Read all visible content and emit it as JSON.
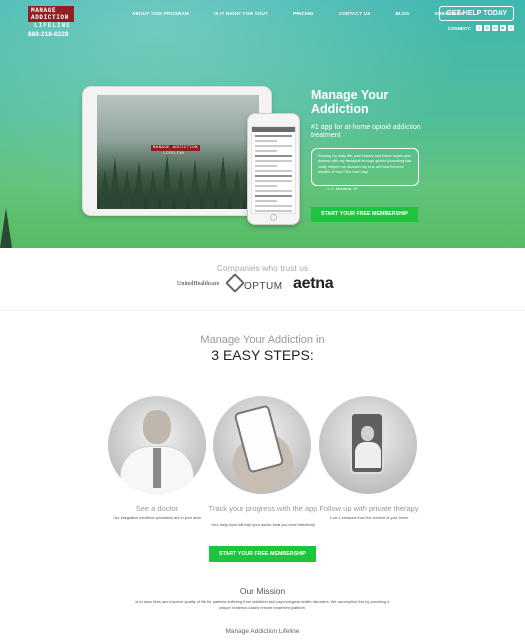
{
  "brand": {
    "logo_line1": "MANAGE ADDICTION",
    "logo_line2": "LIFELINE",
    "phone": "888-218-8228"
  },
  "nav": {
    "items": [
      "ABOUT THIS PROGRAM",
      "IS IT RIGHT FOR YOU?",
      "PRICING",
      "CONTACT US",
      "BLOG",
      "SUBSCRIBE"
    ]
  },
  "header": {
    "help_label": "GET HELP TODAY",
    "connect_label": "CONNECT:",
    "social_icons": [
      "facebook-icon",
      "instagram-icon",
      "linkedin-icon",
      "youtube-icon",
      "twitter-icon"
    ]
  },
  "hero": {
    "title": "Manage Your Addiction",
    "subtitle": "#1 app for at-home opioid addiction treatment",
    "quote": "Sharing my daily life, past history and future hopes and dreams with my therapist through guided journaling has really helped me discover my true self and become mindful of how I live each day.",
    "quote_author": "- L.C. Manteca, N*",
    "cta": "START YOUR FREE MEMBERSHIP",
    "tablet_label1": "MANAGE ADDICTION",
    "tablet_label2": "LIFELINE"
  },
  "companies": {
    "title": "Companies who trust us",
    "logos": [
      "UnitedHealthcare",
      "OPTUM",
      "aetna"
    ]
  },
  "steps": {
    "pre_title": "Manage Your Addiction in",
    "title": "3 EASY STEPS:",
    "items": [
      {
        "title": "See a doctor",
        "desc": "Our integrative medicine specialists are in your area"
      },
      {
        "title": "Track your progress with the app",
        "desc": "Your daily input will help your doctor treat you more effectively"
      },
      {
        "title": "Follow up with private therapy",
        "desc": "1-on-1 sessions from the comfort of your home"
      }
    ],
    "cta": "START YOUR FREE MEMBERSHIP"
  },
  "mission": {
    "title": "Our Mission",
    "text": "is to save lives and improve quality of life for patients suffering from addiction and psychological health disorders. We accomplish this by providing a unique evidence-based remote treatment platform."
  },
  "footer": {
    "name": "Manage Addiction Lifeline"
  },
  "colors": {
    "accent_green": "#1ec43d",
    "logo_red": "#8f1f22",
    "hero_teal": "#3eb7b0"
  }
}
